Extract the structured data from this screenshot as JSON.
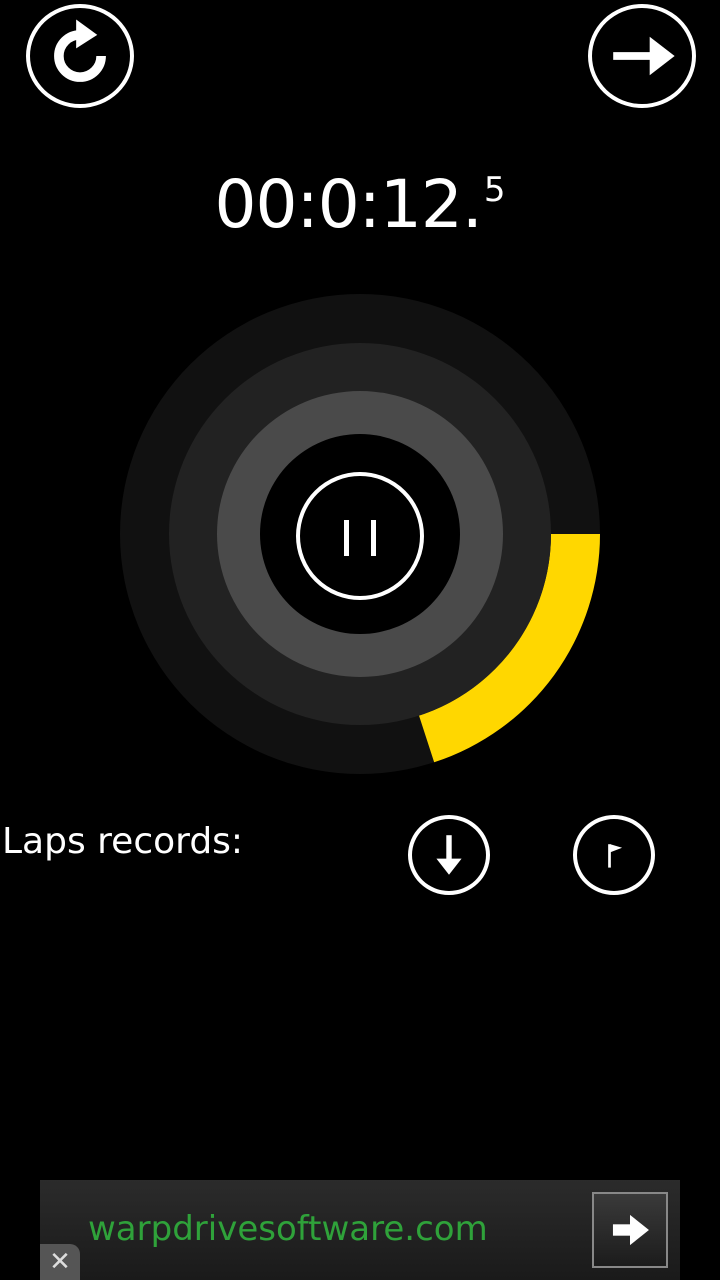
{
  "timer": {
    "main": "00:0:12.",
    "tenth": "5",
    "progress_fraction": 0.2
  },
  "icons": {
    "reset": "refresh-icon",
    "next": "arrow-right-icon",
    "pause": "pause-icon",
    "download": "arrow-down-icon",
    "flag": "flag-icon",
    "ad_arrow": "arrow-right-icon",
    "ad_close": "close-icon"
  },
  "laps": {
    "label": "Laps records:"
  },
  "ad": {
    "text": "warpdrivesoftware.com",
    "close_symbol": "✕"
  },
  "colors": {
    "accent": "#FFD700",
    "ring_outer": "#111111",
    "ring_middle": "#222222",
    "ring_inner": "#4A4A4A",
    "ad_text": "#2FA23A"
  }
}
